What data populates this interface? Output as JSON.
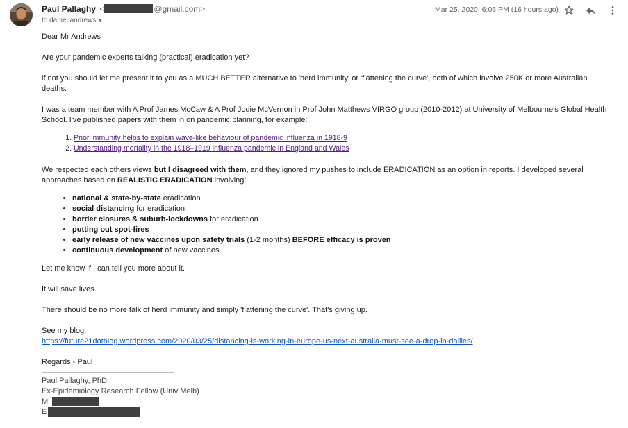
{
  "header": {
    "sender_name": "Paul Pallaghy",
    "sender_lt": "<",
    "sender_domain": "@gmail.com>",
    "to_label": "to daniel.andrews",
    "to_caret": "▾",
    "date": "Mar 25, 2020, 6:06 PM (16 hours ago)",
    "icons": {
      "avatar": "sender-avatar",
      "star": "star-icon",
      "reply": "reply-icon",
      "more": "more-vert-icon"
    }
  },
  "body": {
    "greeting": "Dear Mr Andrews",
    "p1": "Are your pandemic experts talking (practical) eradication yet?",
    "p2": "if not you should let me present it to you as a MUCH BETTER alternative to 'herd immunity' or 'flattening the curve', both of which involve 250K or more Australian deaths.",
    "p3": "I was a team member with A Prof James McCaw & A Prof Jodie McVernon in Prof John Matthews VIRGO group (2010-2012) at University of Melbourne's Global Health School. I've published papers with them in on pandemic planning, for example:",
    "papers": [
      "Prior immunity helps to explain wave-like behaviour of pandemic influenza in 1918-9",
      "Understanding mortality in the 1918–1919 influenza pandemic in England and Wales"
    ],
    "p4": {
      "a": "We respected each others views ",
      "b": "but I disagreed with them",
      "c": ", and they ignored my pushes to include ERADICATION as an option in reports. I developed several approaches based on ",
      "d": "REALISTIC ERADICATION",
      "e": " involving:"
    },
    "approaches": [
      {
        "bold": "national & state-by-state",
        "rest": " eradication"
      },
      {
        "bold": "social distancing",
        "rest": " for eradication"
      },
      {
        "bold": "border closures & suburb-lockdowns",
        "rest": " for eradication"
      },
      {
        "bold": "putting out spot-fires",
        "rest": ""
      },
      {
        "bold": "early release of new vaccines upon safety trials",
        "rest": " (1-2 months) ",
        "bold2": "BEFORE efficacy is proven"
      },
      {
        "bold": "continuous development",
        "rest": " of new vaccines"
      }
    ],
    "p5": "Let me know if I can tell you more about it.",
    "p6": "It will save lives.",
    "p7": "There should be no more talk of herd immunity and simply 'flattening the curve'. That's giving up.",
    "blog_label": "See my blog:",
    "blog_url": "https://future21dotblog.wordpress.com/2020/03/25/distancing-is-working-in-europe-us-next-australia-must-see-a-drop-in-dailies/",
    "regards": "Regards - Paul"
  },
  "signature": {
    "name": "Paul Pallaghy, PhD",
    "title": "Ex-Epidemiology Research Fellow (Univ Melb)",
    "m_label": "M",
    "e_label": "E"
  }
}
